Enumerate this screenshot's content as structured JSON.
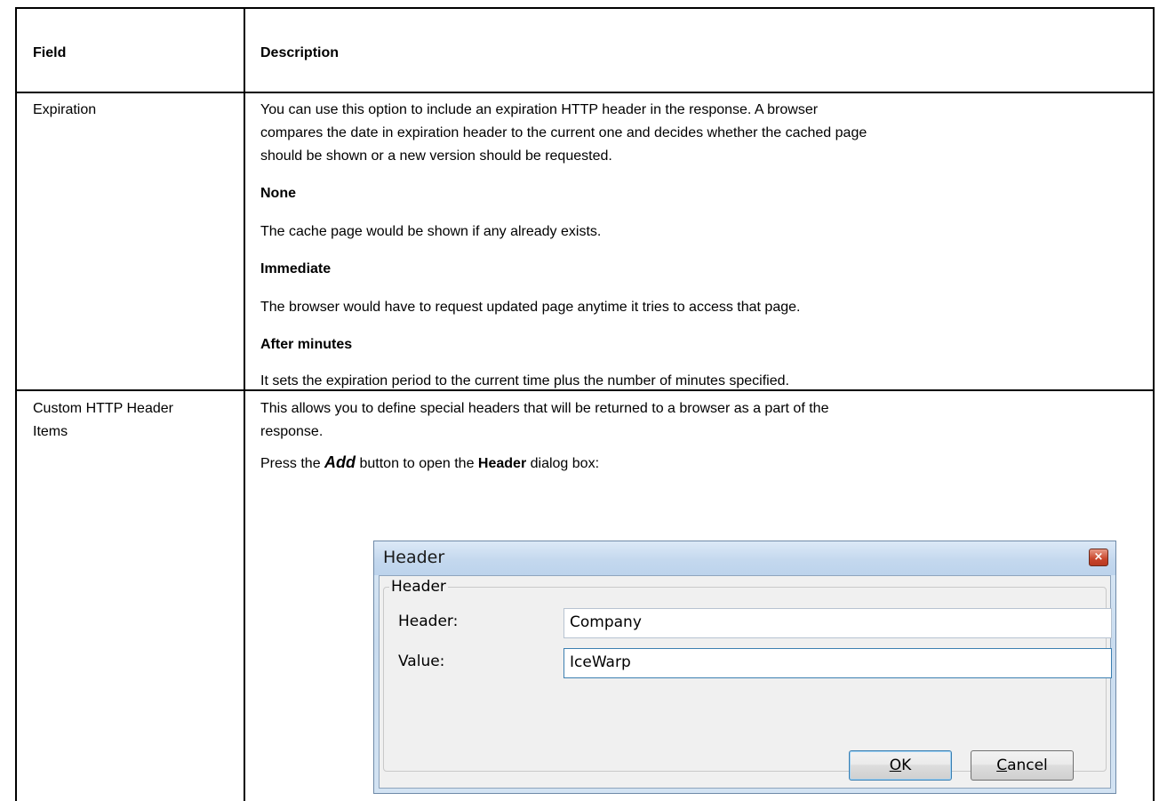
{
  "table": {
    "headers": {
      "field": "Field",
      "description": "Description"
    },
    "rows": [
      {
        "field": "Expiration",
        "intro": [
          "You can use this option to include an expiration HTTP header in the response. A browser",
          "compares the date in expiration header to the current one and decides whether the cached page",
          "should be shown or a new version should be requested."
        ],
        "options": [
          {
            "title": "None",
            "text": "The cache page would be shown if any already exists."
          },
          {
            "title": "Immediate",
            "text": "The browser would have to request updated page anytime it tries to access that page."
          },
          {
            "title": "After minutes",
            "text": "It sets the expiration period to the current time plus the number of minutes specified."
          }
        ]
      },
      {
        "field_lines": [
          "Custom HTTP Header",
          "Items"
        ],
        "intro": [
          "This allows you to define special headers that will be returned to a browser as a part of the",
          "response."
        ],
        "press": {
          "before": "Press the ",
          "add": "Add",
          "middle": " button to open the ",
          "header": "Header",
          "after": " dialog box:"
        }
      }
    ]
  },
  "dialog": {
    "title": "Header",
    "close_glyph": "×",
    "group_label": "Header",
    "header_label": "Header:",
    "header_value": "Company",
    "value_label": "Value:",
    "value_value": "IceWarp",
    "ok_label": "OK",
    "cancel_label": "Cancel"
  }
}
